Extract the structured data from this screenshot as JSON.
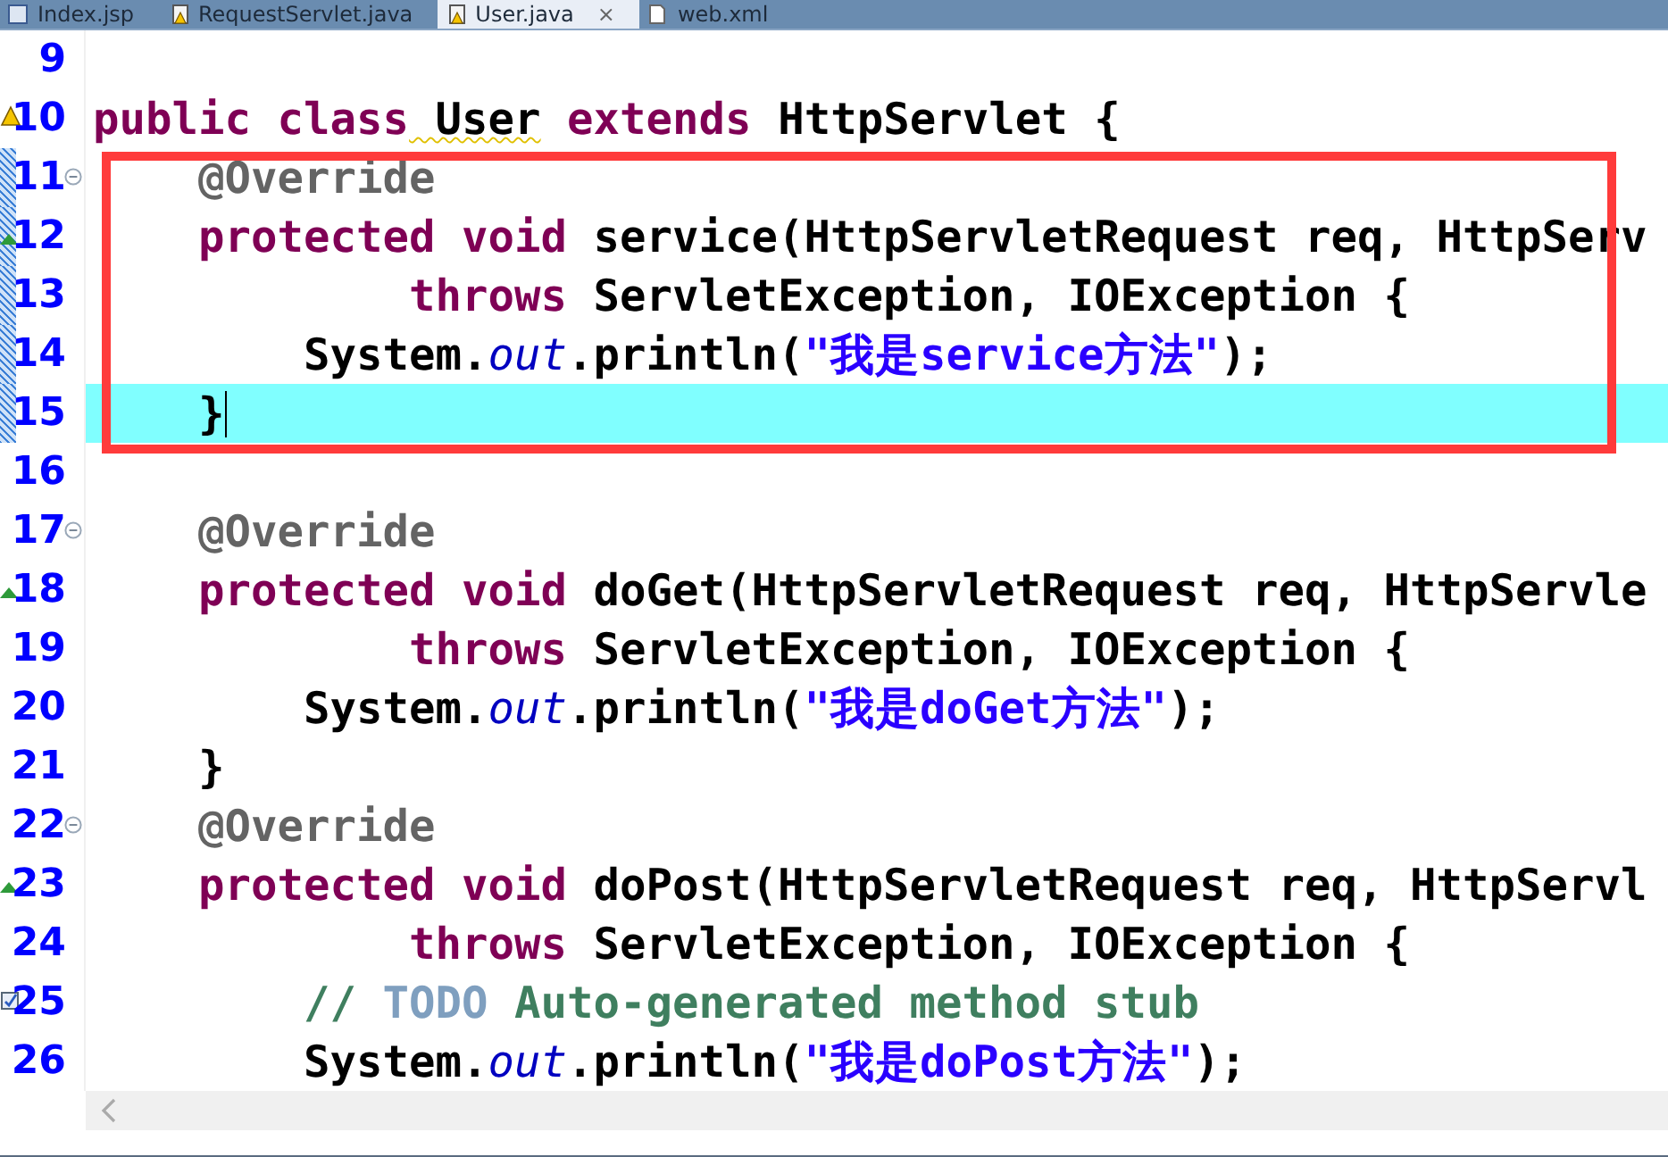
{
  "tabs": [
    {
      "label": "Index.jsp",
      "kind": "java",
      "selected": false,
      "closable": false
    },
    {
      "label": "RequestServlet.java",
      "kind": "java-warning",
      "selected": false,
      "closable": false
    },
    {
      "label": "User.java",
      "kind": "java-warning",
      "selected": true,
      "closable": true
    },
    {
      "label": "web.xml",
      "kind": "file",
      "selected": false,
      "closable": false
    }
  ],
  "close_glyph": "×",
  "editor": {
    "lines": [
      {
        "number": "9",
        "kind": "plain",
        "in_range": false,
        "boxed": false,
        "current": false
      },
      {
        "number": "10",
        "kind": "warning",
        "in_range": false,
        "boxed": false,
        "current": false,
        "tokens": [
          {
            "kind": "keyword",
            "text": "public"
          },
          {
            "kind": "keyword",
            "text": " class"
          },
          {
            "kind": "warned",
            "text": " User"
          },
          {
            "kind": "keyword",
            "text": " extends"
          },
          {
            "kind": "plain",
            "text": " HttpServlet {"
          }
        ]
      },
      {
        "number": "11",
        "kind": "fold",
        "in_range": true,
        "boxed": true,
        "current": false,
        "tokens": [
          {
            "kind": "annotation",
            "text": "    @Override"
          }
        ]
      },
      {
        "number": "12",
        "kind": "override",
        "in_range": true,
        "boxed": true,
        "current": false,
        "tokens": [
          {
            "kind": "keyword",
            "text": "    protected"
          },
          {
            "kind": "keyword",
            "text": " void"
          },
          {
            "kind": "plain",
            "text": " service(HttpServletRequest req, HttpServ"
          }
        ]
      },
      {
        "number": "13",
        "kind": "plain",
        "in_range": true,
        "boxed": true,
        "current": false,
        "tokens": [
          {
            "kind": "keyword",
            "text": "            throws"
          },
          {
            "kind": "plain",
            "text": " ServletException, IOException {"
          }
        ]
      },
      {
        "number": "14",
        "kind": "plain",
        "in_range": true,
        "boxed": true,
        "current": false,
        "tokens": [
          {
            "kind": "plain",
            "text": "        System."
          },
          {
            "kind": "static",
            "text": "out"
          },
          {
            "kind": "plain",
            "text": ".println("
          },
          {
            "kind": "string",
            "text": "\"我是service方法\""
          },
          {
            "kind": "plain",
            "text": ");"
          }
        ]
      },
      {
        "number": "15",
        "kind": "plain",
        "in_range": true,
        "boxed": true,
        "current": true,
        "tokens": [
          {
            "kind": "plain",
            "text": "    }"
          }
        ]
      },
      {
        "number": "16",
        "kind": "plain",
        "in_range": false,
        "boxed": false,
        "current": false
      },
      {
        "number": "17",
        "kind": "fold",
        "in_range": false,
        "boxed": false,
        "current": false,
        "tokens": [
          {
            "kind": "annotation",
            "text": "    @Override"
          }
        ]
      },
      {
        "number": "18",
        "kind": "override",
        "in_range": false,
        "boxed": false,
        "current": false,
        "tokens": [
          {
            "kind": "keyword",
            "text": "    protected"
          },
          {
            "kind": "keyword",
            "text": " void"
          },
          {
            "kind": "plain",
            "text": " doGet(HttpServletRequest req, HttpServle"
          }
        ]
      },
      {
        "number": "19",
        "kind": "plain",
        "in_range": false,
        "boxed": false,
        "current": false,
        "tokens": [
          {
            "kind": "keyword",
            "text": "            throws"
          },
          {
            "kind": "plain",
            "text": " ServletException, IOException {"
          }
        ]
      },
      {
        "number": "20",
        "kind": "plain",
        "in_range": false,
        "boxed": false,
        "current": false,
        "tokens": [
          {
            "kind": "plain",
            "text": "        System."
          },
          {
            "kind": "static",
            "text": "out"
          },
          {
            "kind": "plain",
            "text": ".println("
          },
          {
            "kind": "string",
            "text": "\"我是doGet方法\""
          },
          {
            "kind": "plain",
            "text": ");"
          }
        ]
      },
      {
        "number": "21",
        "kind": "plain",
        "in_range": false,
        "boxed": false,
        "current": false,
        "tokens": [
          {
            "kind": "plain",
            "text": "    }"
          }
        ]
      },
      {
        "number": "22",
        "kind": "fold",
        "in_range": false,
        "boxed": false,
        "current": false,
        "tokens": [
          {
            "kind": "annotation",
            "text": "    @Override"
          }
        ]
      },
      {
        "number": "23",
        "kind": "override",
        "in_range": false,
        "boxed": false,
        "current": false,
        "tokens": [
          {
            "kind": "keyword",
            "text": "    protected"
          },
          {
            "kind": "keyword",
            "text": " void"
          },
          {
            "kind": "plain",
            "text": " doPost(HttpServletRequest req, HttpServl"
          }
        ]
      },
      {
        "number": "24",
        "kind": "plain",
        "in_range": false,
        "boxed": false,
        "current": false,
        "tokens": [
          {
            "kind": "keyword",
            "text": "            throws"
          },
          {
            "kind": "plain",
            "text": " ServletException, IOException {"
          }
        ]
      },
      {
        "number": "25",
        "kind": "task",
        "in_range": false,
        "boxed": false,
        "current": false,
        "tokens": [
          {
            "kind": "comment",
            "text": "        // "
          },
          {
            "kind": "todo",
            "text": "TODO"
          },
          {
            "kind": "comment",
            "text": " Auto-generated method stub"
          }
        ]
      },
      {
        "number": "26",
        "kind": "plain",
        "in_range": false,
        "boxed": false,
        "current": false,
        "tokens": [
          {
            "kind": "plain",
            "text": "        System."
          },
          {
            "kind": "static",
            "text": "out"
          },
          {
            "kind": "plain",
            "text": ".println("
          },
          {
            "kind": "string",
            "text": "\"我是doPost方法\""
          },
          {
            "kind": "plain",
            "text": ");"
          }
        ]
      }
    ]
  }
}
